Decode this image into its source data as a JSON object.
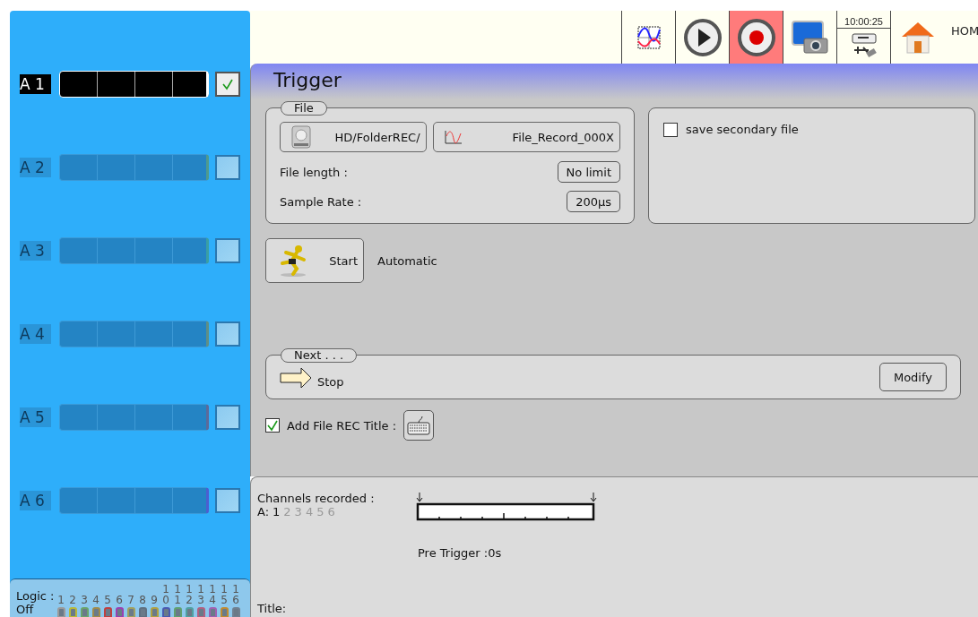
{
  "sidebar": {
    "channels": [
      {
        "label": "A 1",
        "checked": true,
        "color": "#ffffff"
      },
      {
        "label": "A 2",
        "checked": false,
        "color": "#4f9a8e"
      },
      {
        "label": "A 3",
        "checked": false,
        "color": "#3a9fa4"
      },
      {
        "label": "A 4",
        "checked": false,
        "color": "#5f8f86"
      },
      {
        "label": "A 5",
        "checked": false,
        "color": "#5c6a9a"
      },
      {
        "label": "A 6",
        "checked": false,
        "color": "#4b5fd0"
      }
    ],
    "logic": {
      "label": "Logic :",
      "state": "Off",
      "bits": [
        {
          "number": "1",
          "color": "#9a9a9a"
        },
        {
          "number": "2",
          "color": "#b8b83a"
        },
        {
          "number": "3",
          "color": "#6aa36a"
        },
        {
          "number": "4",
          "color": "#a08a4a"
        },
        {
          "number": "5",
          "color": "#c04040"
        },
        {
          "number": "6",
          "color": "#9a40b0"
        },
        {
          "number": "7",
          "color": "#a0a060"
        },
        {
          "number": "8",
          "color": "#607080"
        },
        {
          "number": "9",
          "color": "#b0a040"
        },
        {
          "number": "10",
          "color": "#4a5ab0"
        },
        {
          "number": "11",
          "color": "#60a070"
        },
        {
          "number": "12",
          "color": "#50a0a0"
        },
        {
          "number": "13",
          "color": "#b06080"
        },
        {
          "number": "14",
          "color": "#a060b0"
        },
        {
          "number": "15",
          "color": "#c08a30"
        },
        {
          "number": "16",
          "color": "#708090"
        }
      ]
    }
  },
  "toolbar": {
    "items": [
      {
        "kind": "chart",
        "selected": false
      },
      {
        "kind": "play",
        "selected": false
      },
      {
        "kind": "record",
        "selected": true
      },
      {
        "kind": "camera",
        "selected": false
      },
      {
        "kind": "storage",
        "selected": false,
        "time": "10:00:25"
      },
      {
        "kind": "home",
        "selected": false
      }
    ],
    "home_label": "HOM"
  },
  "panel": {
    "title": "Trigger",
    "file_group": {
      "legend": "File",
      "folder": "HD/FolderREC/",
      "file_name": "File_Record_000X",
      "rows": [
        {
          "label": "File length :",
          "value": "No limit"
        },
        {
          "label": "Sample Rate :",
          "value": "200µs"
        }
      ]
    },
    "secondary": {
      "label": "save secondary file",
      "checked": false
    },
    "start": {
      "button": "Start",
      "mode": "Automatic"
    },
    "next_group": {
      "legend": "Next . . .",
      "action": "Stop",
      "button": "Modify"
    },
    "title_option": {
      "label": "Add File REC Title :",
      "checked": true
    }
  },
  "summary": {
    "channels_label": "Channels recorded :",
    "prefix": "A:",
    "channels": [
      {
        "number": "1",
        "active": true
      },
      {
        "number": "2",
        "active": false
      },
      {
        "number": "3",
        "active": false
      },
      {
        "number": "4",
        "active": false
      },
      {
        "number": "5",
        "active": false
      },
      {
        "number": "6",
        "active": false
      }
    ],
    "pre_trigger": "Pre Trigger :0s",
    "title_label": "Title:"
  }
}
